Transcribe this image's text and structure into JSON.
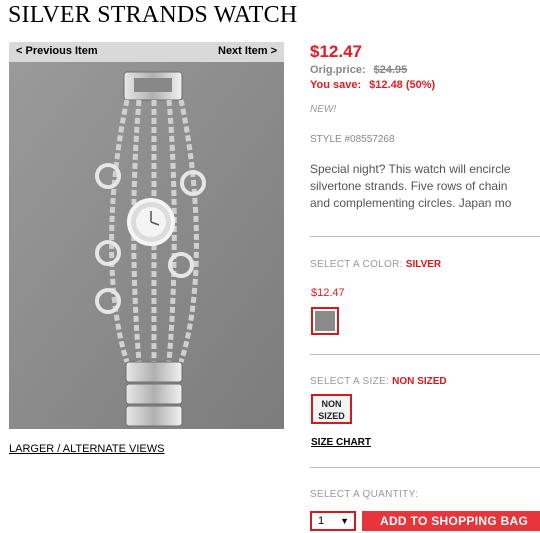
{
  "product": {
    "title": "SILVER STRANDS WATCH",
    "price": "$12.47",
    "orig_label": "Orig.price:",
    "orig_value": "$24.95",
    "save_label": "You save:",
    "save_value": "$12.48 (50%)",
    "badge": "NEW!",
    "style": "STYLE #08557268",
    "description": [
      "Special night? This watch will encircle",
      "silvertone strands. Five rows of chain",
      "and complementing circles. Japan mo"
    ]
  },
  "nav": {
    "prev": "< Previous Item",
    "next": "Next Item >"
  },
  "image": {
    "alt_link": "LARGER / ALTERNATE VIEWS",
    "icon": "watch-photo"
  },
  "color": {
    "label": "SELECT A COLOR:",
    "value": "SILVER",
    "swatch_price": "$12.47"
  },
  "size": {
    "label": "SELECT A SIZE:",
    "value": "NON SIZED",
    "option_line1": "NON",
    "option_line2": "SIZED",
    "chart_link": "SIZE CHART"
  },
  "quantity": {
    "label": "SELECT A QUANTITY:",
    "value": "1",
    "caret": "▼"
  },
  "cart": {
    "button": "ADD TO SHOPPING BAG"
  },
  "colors": {
    "accent": "#e31b23",
    "button": "#e8343b",
    "nav_bg": "#d9d9d9"
  }
}
